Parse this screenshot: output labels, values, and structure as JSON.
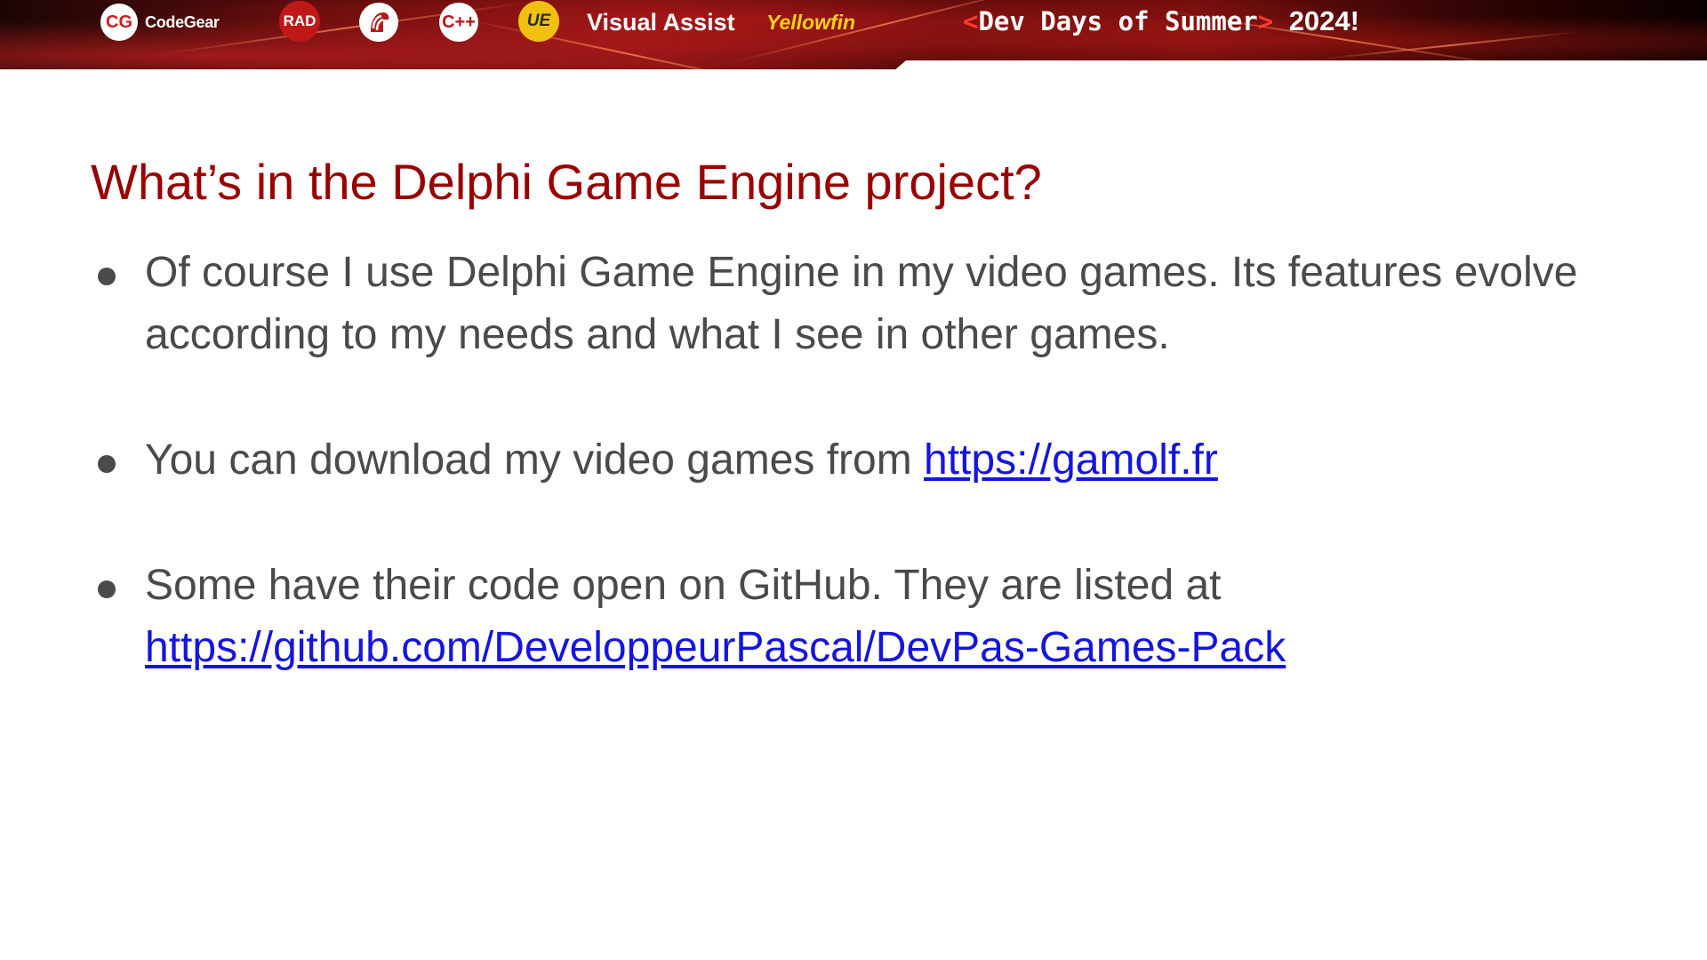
{
  "banner": {
    "logos": {
      "codegear_mark": "CG",
      "codegear_label": "CodeGear",
      "rad": "RAD",
      "cpp": "C++",
      "ue": "UE",
      "visual_assist": "Visual Assist",
      "yellowfin": "Yellowfin"
    },
    "event": {
      "open_bracket": "<",
      "name": "Dev Days of Summer",
      "close_bracket": ">",
      "year": "2024!"
    },
    "colors": {
      "bracket": "#ff3b2f",
      "banner_base": "#5a0b0b"
    }
  },
  "slide": {
    "title": "What’s in the Delphi Game Engine project?",
    "bullets": [
      {
        "text": "Of course I use Delphi Game Engine in my video games. Its features evolve according to my needs and what I see in other games."
      },
      {
        "text": "You can download my video games from ",
        "link": "https://gamolf.fr"
      },
      {
        "text": "Some have their code open on GitHub. They are listed at",
        "link": "https://github.com/DeveloppeurPascal/DevPas-Games-Pack"
      }
    ],
    "colors": {
      "title": "#990000",
      "body": "#4a4a4a",
      "link": "#1515dd"
    }
  }
}
